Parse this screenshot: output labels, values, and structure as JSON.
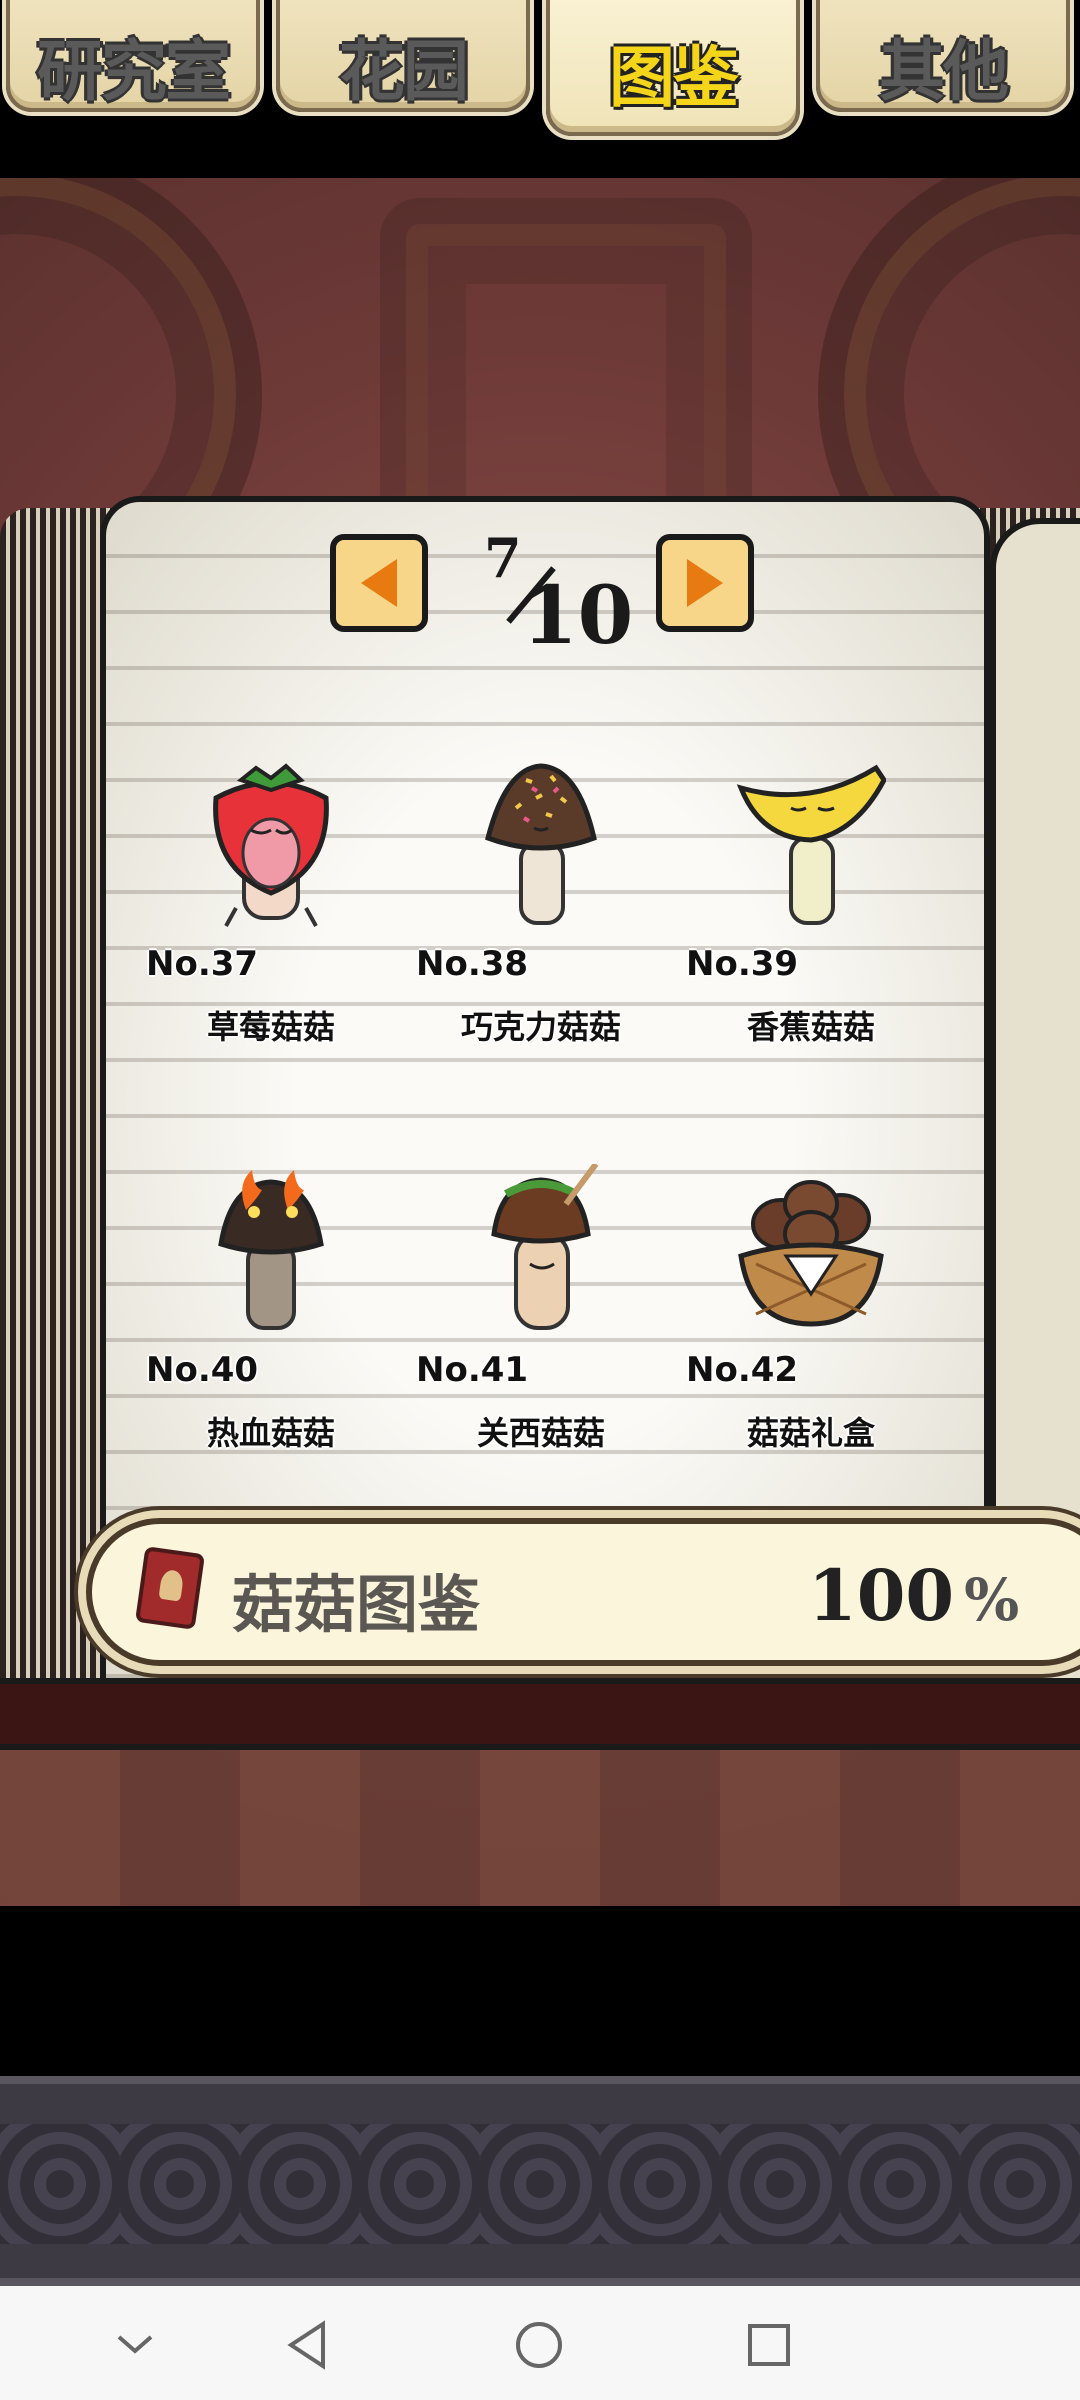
{
  "tabs": [
    {
      "label": "研究室",
      "active": false
    },
    {
      "label": "花园",
      "active": false
    },
    {
      "label": "图鉴",
      "active": true
    },
    {
      "label": "其他",
      "active": false
    }
  ],
  "pager": {
    "current": "7",
    "total": "10"
  },
  "items": [
    {
      "no": "No.37",
      "name": "草莓菇菇",
      "icon": "strawberry-mushroom-icon"
    },
    {
      "no": "No.38",
      "name": "巧克力菇菇",
      "icon": "chocolate-mushroom-icon"
    },
    {
      "no": "No.39",
      "name": "香蕉菇菇",
      "icon": "banana-mushroom-icon"
    },
    {
      "no": "No.40",
      "name": "热血菇菇",
      "icon": "fiery-mushroom-icon"
    },
    {
      "no": "No.41",
      "name": "关西菇菇",
      "icon": "kansai-mushroom-icon"
    },
    {
      "no": "No.42",
      "name": "菇菇礼盒",
      "icon": "mushroom-gift-basket-icon"
    }
  ],
  "collection": {
    "label": "菇菇图鉴",
    "percent": "100",
    "percent_symbol": "%"
  },
  "colors": {
    "accent": "#e87a12",
    "tab_active_text": "#f5d51a",
    "book_red": "#a12a2a"
  }
}
